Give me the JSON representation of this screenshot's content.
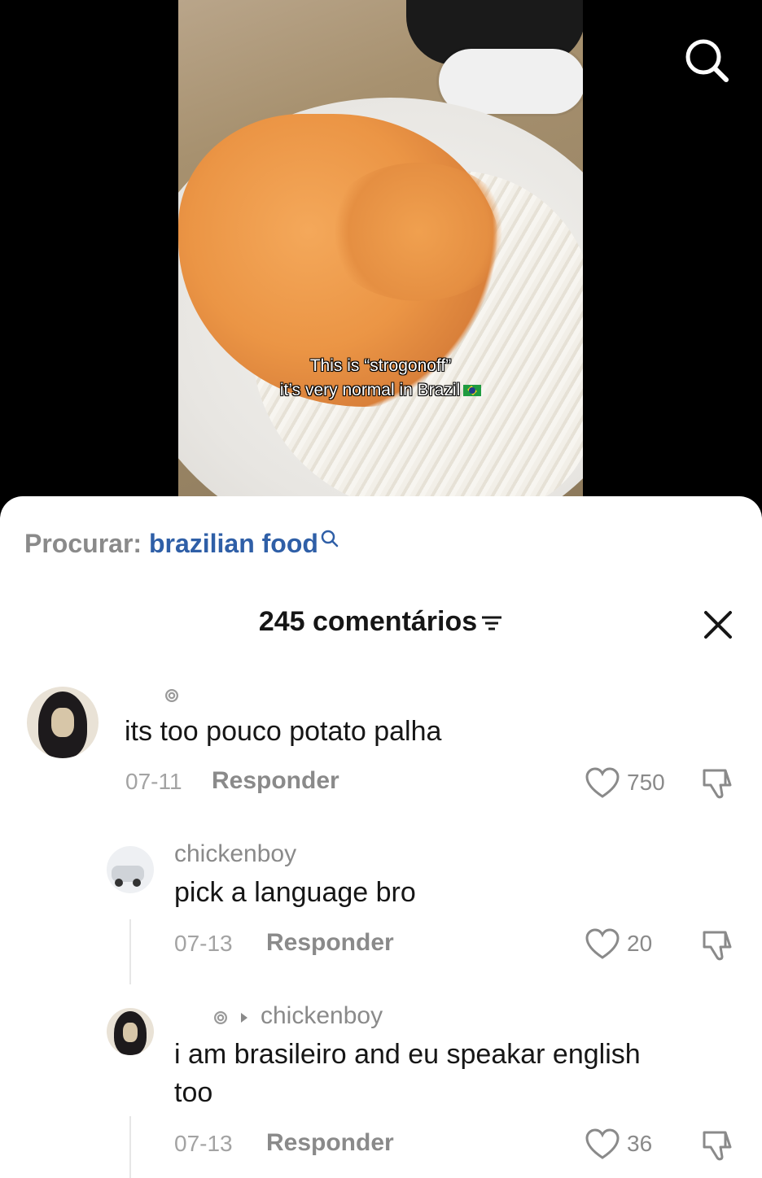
{
  "video": {
    "caption_line1": "This is “strogonoff”",
    "caption_line2": "it’s very normal in Brazil"
  },
  "search_bar": {
    "prefix": "Procurar:",
    "term": "brazilian food"
  },
  "comments_header": {
    "count_label": "245 comentários"
  },
  "comments": [
    {
      "username": "",
      "text": "its too pouco potato palha",
      "date": "07-11",
      "reply_label": "Responder",
      "likes": "750"
    },
    {
      "username": "chickenboy",
      "text": "pick a language bro",
      "date": "07-13",
      "reply_label": "Responder",
      "likes": "20"
    },
    {
      "reply_to": "chickenboy",
      "text_line1": "i am brasileiro and eu speakar english",
      "text_line2": "too",
      "date": "07-13",
      "reply_label": "Responder",
      "likes": "36"
    }
  ],
  "colors": {
    "search_term": "#2f5fa7",
    "text_primary": "#161616",
    "text_secondary": "#8a8a8a"
  },
  "icons": [
    "search-icon",
    "close-icon",
    "filter-icon",
    "heart-icon",
    "dislike-icon"
  ]
}
